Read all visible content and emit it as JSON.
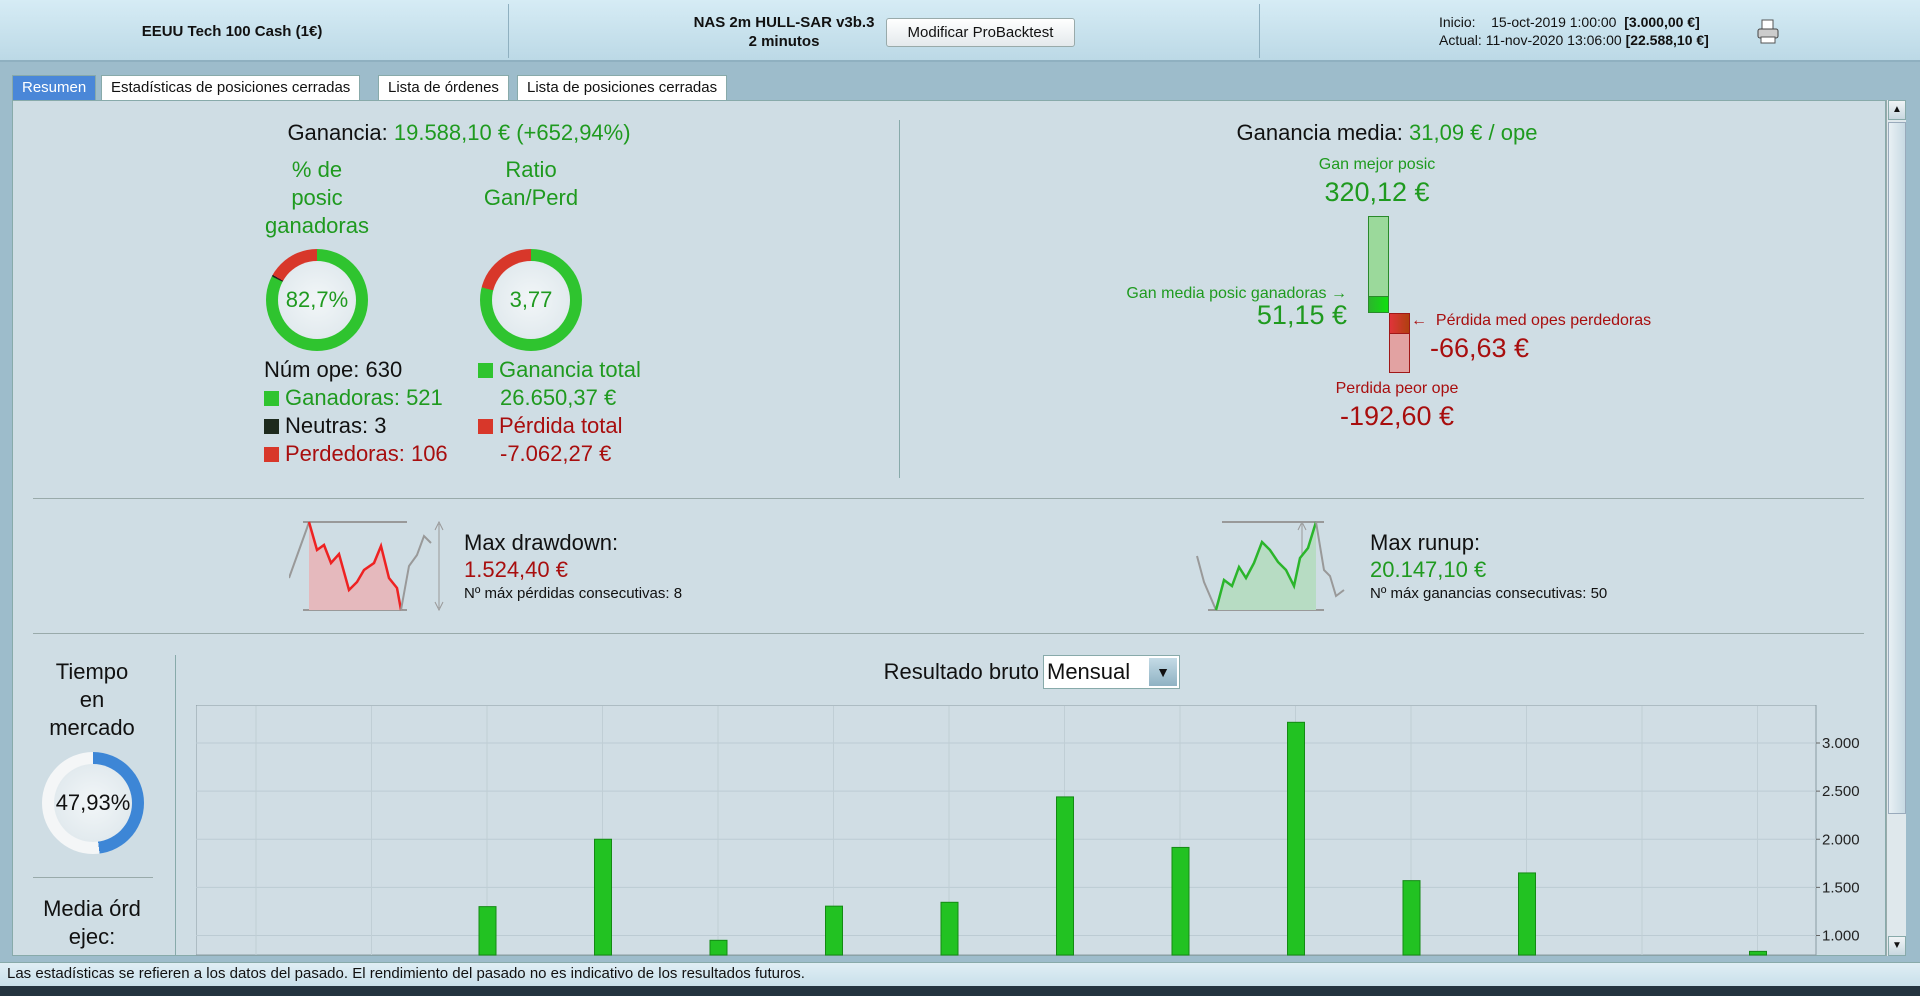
{
  "header": {
    "instrument": "EEUU Tech 100 Cash (1€)",
    "system_name": "NAS 2m HULL-SAR v3b.3",
    "timeframe": "2 minutos",
    "modify_button": "Modificar ProBacktest",
    "start_label": "Inicio:",
    "start_date": "15-oct-2019 1:00:00",
    "start_capital": "[3.000,00 €]",
    "current_label": "Actual:",
    "current_date": "11-nov-2020 13:06:00",
    "current_capital": "[22.588,10 €]",
    "print_icon": "printer-icon"
  },
  "tabs": [
    {
      "label": "Resumen",
      "active": true
    },
    {
      "label": "Estadísticas de posiciones cerradas"
    },
    {
      "label": "Lista de órdenes"
    },
    {
      "label": "Lista de posiciones cerradas"
    }
  ],
  "summary": {
    "gain_label": "Ganancia:",
    "gain_value": "19.588,10 € (+652,94%)",
    "win_pct_title": [
      "% de",
      "posic",
      "ganadoras"
    ],
    "win_pct": "82,7%",
    "win_fraction": 0.827,
    "ratio_title": [
      "Ratio",
      "Gan/Perd"
    ],
    "ratio": "3,77",
    "ratio_gain_share": 0.79,
    "num_ope": "Núm ope: 630",
    "winners": "Ganadoras: 521",
    "neutral": "Neutras: 3",
    "losers": "Perdedoras: 106",
    "total_gain_label": "Ganancia total",
    "total_gain": "26.650,37 €",
    "total_loss_label": "Pérdida total",
    "total_loss": "-7.062,27 €"
  },
  "average": {
    "label": "Ganancia media:",
    "value": "31,09 € / ope",
    "best_label": "Gan mejor posic",
    "best": "320,12 €",
    "avg_win_label": "Gan media posic ganadoras",
    "avg_win": "51,15 €",
    "avg_loss_label": "Pérdida med opes perdedoras",
    "avg_loss": "-66,63 €",
    "worst_label": "Perdida peor ope",
    "worst": "-192,60 €"
  },
  "drawdown": {
    "label": "Max drawdown:",
    "value": "1.524,40 €",
    "consecutive": "Nº máx pérdidas consecutivas: 8"
  },
  "runup": {
    "label": "Max runup:",
    "value": "20.147,10 €",
    "consecutive": "Nº máx ganancias consecutivas: 50"
  },
  "market_time": {
    "title": [
      "Tiempo",
      "en",
      "mercado"
    ],
    "value": "47,93%",
    "fraction": 0.4793,
    "orders_title": [
      "Media órd",
      "ejec:"
    ]
  },
  "colors": {
    "gain": "#1f9a1f",
    "loss": "#a80e0e",
    "accent": "#4a87d8"
  },
  "chart_data": {
    "type": "bar",
    "title": "Resultado bruto",
    "period_select": "Mensual",
    "yticks": [
      "3.000",
      "2.500",
      "2.000",
      "1.500",
      "1.000"
    ],
    "ytick_values": [
      3000,
      2500,
      2000,
      1500,
      1000
    ],
    "ylim_visible": [
      780,
      3300
    ],
    "values": [
      null,
      null,
      1300,
      2000,
      950,
      1305,
      1345,
      2440,
      1915,
      3215,
      1570,
      1650,
      null,
      835
    ]
  },
  "status": "Las estadísticas se refieren a los datos del pasado. El rendimiento del pasado no es indicativo de los resultados futuros."
}
